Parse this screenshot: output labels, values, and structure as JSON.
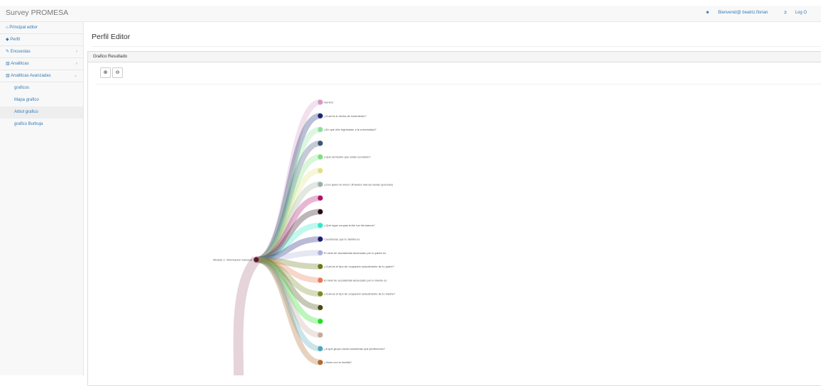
{
  "app": {
    "title": "Survey PROMESA",
    "welcome": "Bienvenid@ beatriz.florian",
    "logout": "Log O"
  },
  "sidebar": {
    "items": [
      {
        "icon": "home-icon",
        "label": "Principal editor"
      },
      {
        "icon": "tag-icon",
        "label": "Perfil"
      },
      {
        "icon": "pencil-icon",
        "label": "Encuestas",
        "chevron": "‹"
      },
      {
        "icon": "bar-chart-icon",
        "label": "Analiticas",
        "chevron": "‹"
      },
      {
        "icon": "bar-chart-icon",
        "label": "Analiticas Avanzadas",
        "chevron": "⌄"
      }
    ],
    "sub_items": [
      {
        "label": "graficos"
      },
      {
        "label": "Mapa grafico"
      },
      {
        "label": "Arbol grafico",
        "active": true
      },
      {
        "label": "grafico Burbuja"
      }
    ]
  },
  "page": {
    "title": "Perfil Editor",
    "panel_title": "Grafico Resultado",
    "zoom_in": "⊕",
    "zoom_out": "⊖"
  },
  "tree": {
    "root_label": "Modulo 1: Informacion General",
    "nodes": [
      {
        "label": "Genero",
        "color": "#d39ac0"
      },
      {
        "label": "¿Cuál es tu fecha de nacimiento?",
        "color": "#1b2a70"
      },
      {
        "label": "¿En qué año ingresaste a la universidad?",
        "color": "#8be09a"
      },
      {
        "label": "",
        "color": "#3e5478"
      },
      {
        "label": "¿Qué semestre que estas cursando?",
        "color": "#7fe080"
      },
      {
        "label": "",
        "color": "#e0e080"
      },
      {
        "label": "¿Con quién tú vives? (Puedes marcar varias opciones)",
        "color": "#9ab0a2"
      },
      {
        "label": "",
        "color": "#b0106a"
      },
      {
        "label": "",
        "color": "#2a0a18"
      },
      {
        "label": "¿Qué lugar ocupas entre tus hermanos?",
        "color": "#30e8c8"
      },
      {
        "label": "Consideras que tu familia es",
        "color": "#1e1a78"
      },
      {
        "label": "El nivel de escolaridad alcanzado por tu padre es",
        "color": "#a8b0d8"
      },
      {
        "label": "¿Cuál es el tipo de ocupación actualmente de tu padre?",
        "color": "#6a7a1a"
      },
      {
        "label": "El nivel de escolaridad alcanzado por tu madre es",
        "color": "#e87850"
      },
      {
        "label": "¿Cuál es el tipo de ocupación actualmente de tu madre?",
        "color": "#7a8a20"
      },
      {
        "label": "",
        "color": "#4a4a10"
      },
      {
        "label": "",
        "color": "#20e020"
      },
      {
        "label": "",
        "color": "#c8a898"
      },
      {
        "label": "¿A qué grupo racial consideras que perteneces?",
        "color": "#50a8b8"
      },
      {
        "label": "¿Vives con tu familia?",
        "color": "#b06a30"
      }
    ]
  }
}
